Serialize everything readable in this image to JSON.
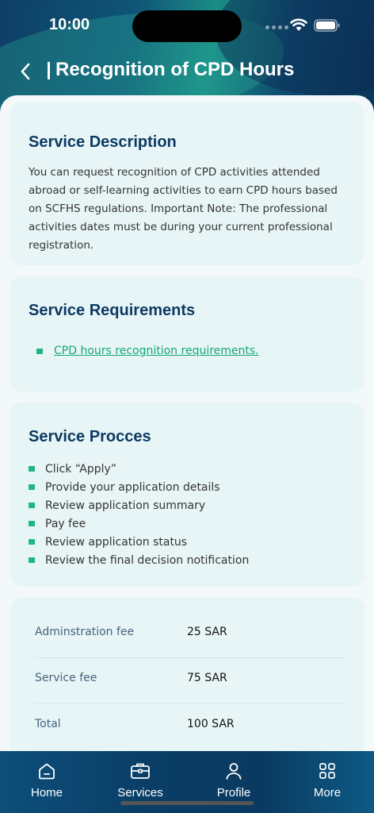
{
  "status": {
    "time": "10:00"
  },
  "header": {
    "title": "Recognition of CPD Hours"
  },
  "description": {
    "title": "Service Description",
    "text": "You can request recognition of CPD activities attended abroad or self-learning activities to earn CPD hours based on SCFHS regulations.  Important Note: The professional activities dates must be during your current professional registration."
  },
  "requirements": {
    "title": "Service Requirements",
    "link": "CPD hours recognition requirements."
  },
  "process": {
    "title": "Service Procces",
    "steps": [
      "Click “Apply”",
      " Provide your application details",
      " Review application summary",
      " Pay fee",
      " Review application status",
      " Review the final decision notification"
    ]
  },
  "fees": [
    {
      "label": "Adminstration fee",
      "value": "25 SAR"
    },
    {
      "label": "Service fee",
      "value": "75 SAR"
    },
    {
      "label": "Total",
      "value": "100 SAR"
    }
  ],
  "tabs": [
    {
      "label": "Home",
      "icon": "home-icon"
    },
    {
      "label": "Services",
      "icon": "briefcase-icon"
    },
    {
      "label": "Profile",
      "icon": "person-icon"
    },
    {
      "label": "More",
      "icon": "grid-icon"
    }
  ],
  "colors": {
    "accent": "#1fb584",
    "title": "#0c3a63",
    "tabbar": "#0a3e66"
  }
}
